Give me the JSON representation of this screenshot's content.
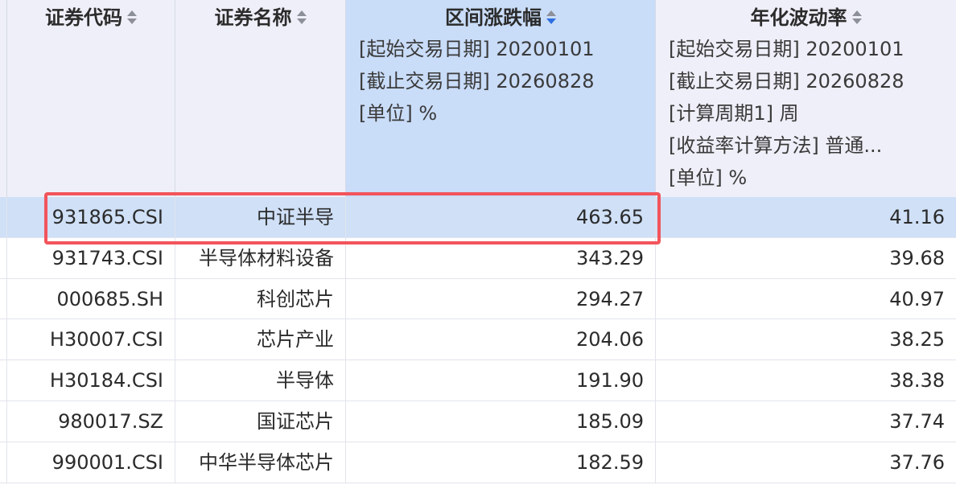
{
  "columns": [
    {
      "title": "证券代码",
      "params": []
    },
    {
      "title": "证券名称",
      "params": []
    },
    {
      "title": "区间涨跌幅",
      "params": [
        "[起始交易日期] 20200101",
        "[截止交易日期] 20260828",
        "[单位] %"
      ]
    },
    {
      "title": "年化波动率",
      "params": [
        "[起始交易日期] 20200101",
        "[截止交易日期] 20260828",
        "[计算周期1] 周",
        "[收益率计算方法] 普通...",
        "[单位] %"
      ]
    }
  ],
  "sort": {
    "column": "区间涨跌幅",
    "direction": "desc"
  },
  "rows": [
    {
      "code": "931865.CSI",
      "name": "中证半导",
      "change": "463.65",
      "vol": "41.16",
      "selected": true
    },
    {
      "code": "931743.CSI",
      "name": "半导体材料设备",
      "change": "343.29",
      "vol": "39.68"
    },
    {
      "code": "000685.SH",
      "name": "科创芯片",
      "change": "294.27",
      "vol": "40.97"
    },
    {
      "code": "H30007.CSI",
      "name": "芯片产业",
      "change": "204.06",
      "vol": "38.25"
    },
    {
      "code": "H30184.CSI",
      "name": "半导体",
      "change": "191.90",
      "vol": "38.38"
    },
    {
      "code": "980017.SZ",
      "name": "国证芯片",
      "change": "185.09",
      "vol": "37.74"
    },
    {
      "code": "990001.CSI",
      "name": "中华半导体芯片",
      "change": "182.59",
      "vol": "37.76"
    }
  ],
  "colors": {
    "highlight_border": "#f2545b",
    "sorted_header": "#c9dcf8",
    "selected_row": "#cfe0f7",
    "sort_active": "#2f6fe0"
  }
}
